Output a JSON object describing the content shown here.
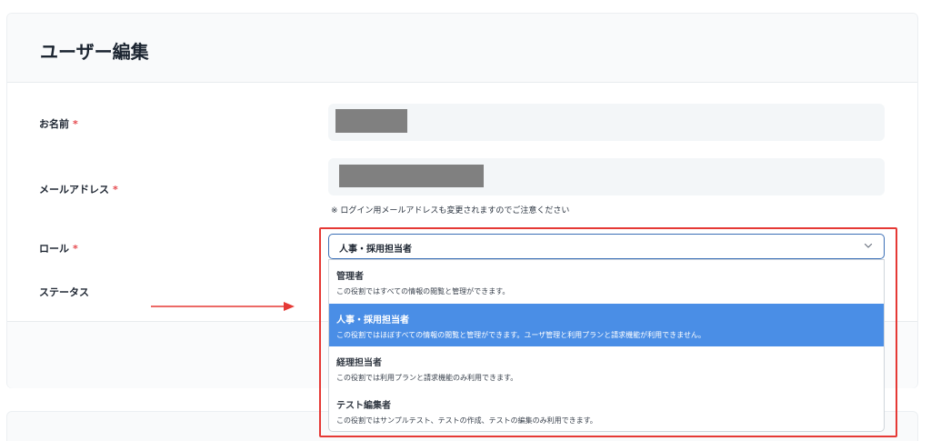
{
  "page": {
    "title": "ユーザー編集"
  },
  "fields": {
    "name_label": "お名前",
    "email_label": "メールアドレス",
    "email_hint": "※ ログイン用メールアドレスも変更されますのでご注意ください",
    "role_label": "ロール",
    "status_label": "ステータス",
    "required_mark": "*"
  },
  "role_select": {
    "value": "人事・採用担当者",
    "options": [
      {
        "title": "管理者",
        "description": "この役割ではすべての情報の閲覧と管理ができます。",
        "selected": false
      },
      {
        "title": "人事・採用担当者",
        "description": "この役割ではほぼすべての情報の閲覧と管理ができます。ユーザ管理と利用プランと請求機能が利用できません。",
        "selected": true
      },
      {
        "title": "経理担当者",
        "description": "この役割では利用プランと請求機能のみ利用できます。",
        "selected": false
      },
      {
        "title": "テスト編集者",
        "description": "この役割ではサンプルテスト、テストの作成、テストの編集のみ利用できます。",
        "selected": false
      }
    ]
  },
  "colors": {
    "accent": "#4a8ee6",
    "annotation": "#e53935",
    "required": "#e5484d"
  }
}
